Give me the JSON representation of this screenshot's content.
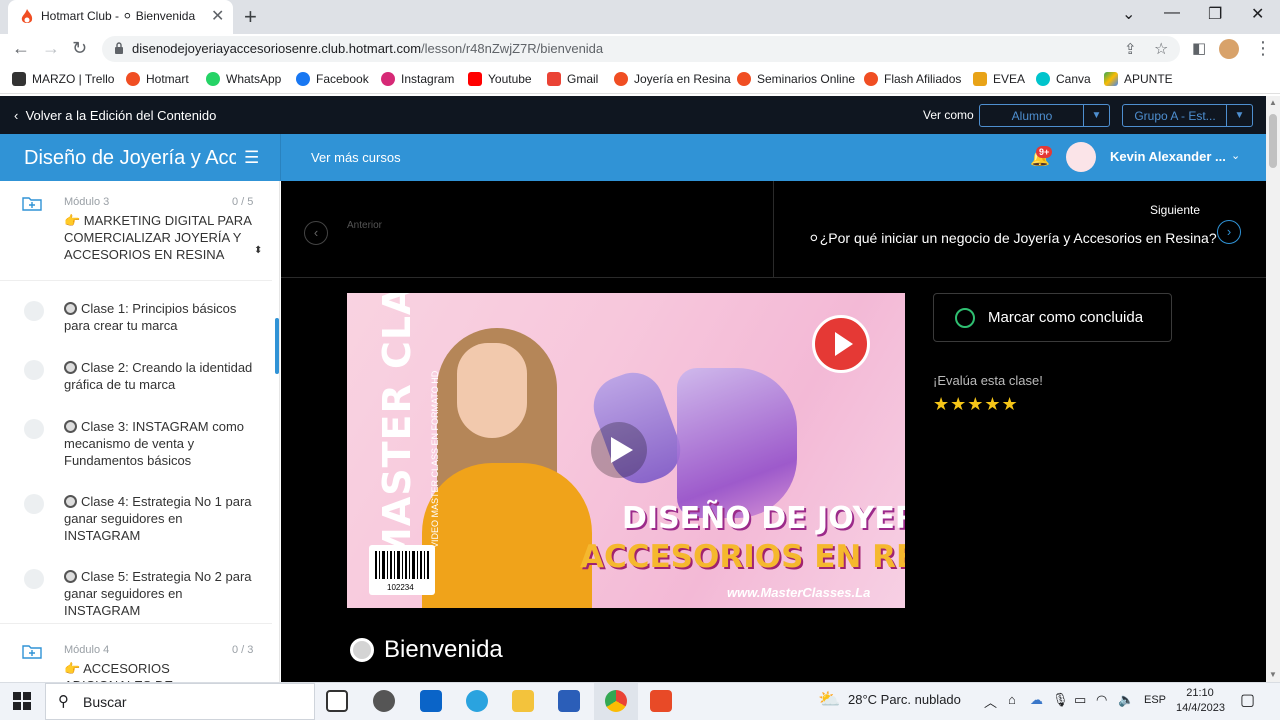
{
  "browser": {
    "tab_title": "Hotmart Club - ⚪ Bienvenida",
    "url_host": "disenodejoyeriayaccesoriosenre.club.hotmart.com",
    "url_path": "/lesson/r48nZwjZ7R/bienvenida",
    "bookmarks": [
      "MARZO | Trello",
      "Hotmart",
      "WhatsApp",
      "Facebook",
      "Instagram",
      "Youtube",
      "Gmail",
      "Joyería en Resina",
      "Seminarios Online",
      "Flash Afiliados",
      "EVEA",
      "Canva",
      "APUNTE"
    ]
  },
  "topbar": {
    "back_label": "Volver a la Edición del Contenido",
    "view_as_label": "Ver como",
    "view_as_value": "Alumno",
    "group_value": "Grupo A - Est..."
  },
  "header": {
    "course_title": "Diseño de Joyería y Accesorios en Resina",
    "more_courses": "Ver más cursos",
    "notif_badge": "9+",
    "user_name": "Kevin Alexander ..."
  },
  "sidebar": {
    "module3": {
      "label": "Módulo 3",
      "count": "0 / 5",
      "title": "👉 MARKETING DIGITAL PARA COMERCIALIZAR JOYERÍA Y ACCESORIOS EN RESINA"
    },
    "lessons": [
      "Clase 1: Principios básicos para crear tu marca",
      "Clase 2: Creando la identidad gráfica de tu marca",
      "Clase 3: INSTAGRAM como mecanismo de venta y Fundamentos básicos",
      "Clase 4: Estrategia No 1 para ganar seguidores en INSTAGRAM",
      "Clase 5: Estrategia No 2 para ganar seguidores en INSTAGRAM"
    ],
    "module4": {
      "label": "Módulo 4",
      "count": "0 / 3",
      "title": "👉 ACCESORIOS ADICIONALES DE REFERENTES EN LA"
    }
  },
  "lesson_nav": {
    "prev_label": "Anterior",
    "next_label": "Siguiente",
    "next_title": "⚪¿Por qué iniciar un negocio de Joyería y Accesorios en Resina?"
  },
  "video": {
    "master_class": "MASTER CLASS",
    "subtitle": "VIDEO MASTER CLASS EN FORMATO HD",
    "line1": "DISEÑO DE JOYERÍA Y",
    "line2": "ACCESORIOS EN RESINA",
    "site": "www.MasterClasses.La",
    "barcode_num": "102234"
  },
  "right": {
    "mark_done": "Marcar como concluida",
    "rate_label": "¡Evalúa esta clase!",
    "stars": "★★★★★"
  },
  "lesson_title": "Bienvenida",
  "taskbar": {
    "search": "Buscar",
    "weather": "28°C  Parc. nublado",
    "lang": "ESP",
    "time": "21:10",
    "date": "14/4/2023"
  }
}
